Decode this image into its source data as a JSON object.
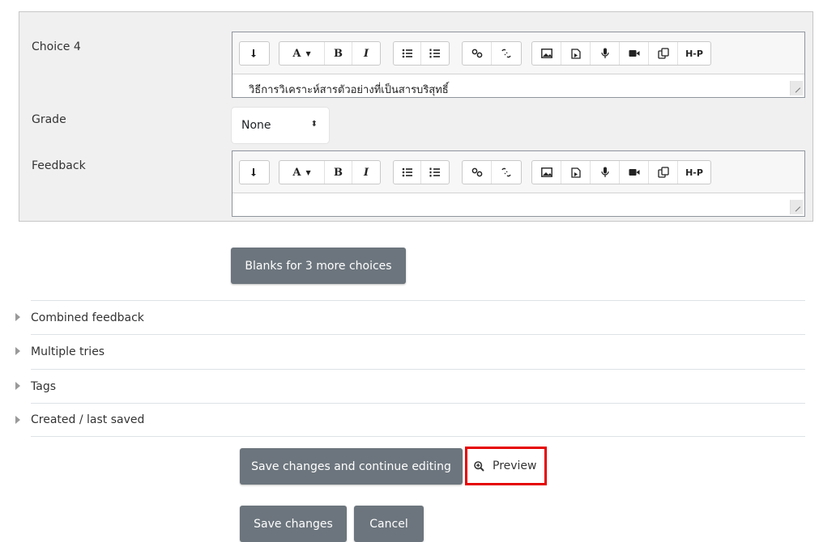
{
  "choice": {
    "label": "Choice 4",
    "content": "วิธีการวิเคราะห์สารตัวอย่างที่เป็นสารบริสุทธิ์"
  },
  "grade": {
    "label": "Grade",
    "selected": "None"
  },
  "feedback": {
    "label": "Feedback",
    "content": ""
  },
  "toolbar": {
    "font_label": "A",
    "bold_label": "B",
    "italic_label": "I",
    "h5p_label": "H-P"
  },
  "blanks_button": "Blanks for 3 more choices",
  "sections": [
    {
      "label": "Combined feedback"
    },
    {
      "label": "Multiple tries"
    },
    {
      "label": "Tags"
    },
    {
      "label": "Created / last saved"
    }
  ],
  "actions": {
    "save_continue": "Save changes and continue editing",
    "preview": "Preview",
    "save": "Save changes",
    "cancel": "Cancel"
  },
  "colors": {
    "button_grey": "#6c757d",
    "highlight_red": "#e60000",
    "panel_bg": "#f0f0f0"
  }
}
